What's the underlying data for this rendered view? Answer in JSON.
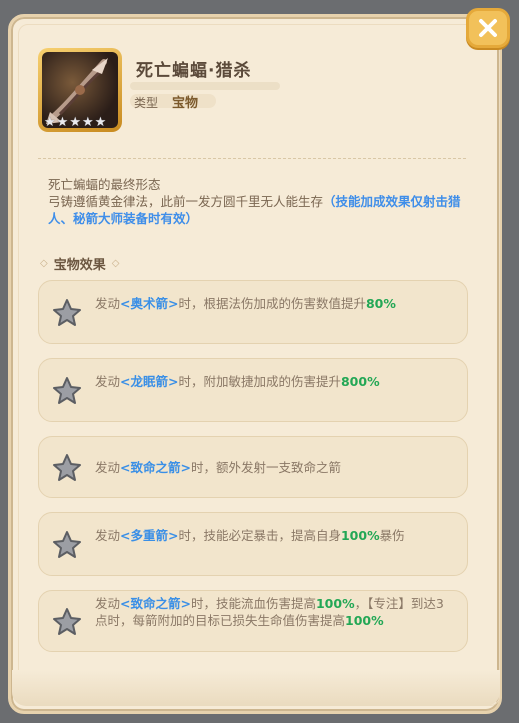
{
  "item": {
    "title": "死亡蝙蝠·猎杀",
    "type_label": "类型",
    "type_value": "宝物",
    "stars": [
      "★",
      "★",
      "★",
      "★",
      "★"
    ]
  },
  "description": {
    "line1": "死亡蝙蝠的最终形态",
    "line2": "弓铸遵循黄金律法，此前一发方圆千里无人能生存",
    "note": "（技能加成效果仅射击猎人、秘箭大师装备时有效）"
  },
  "section": {
    "title": "宝物效果"
  },
  "effects": [
    {
      "pre": "发动",
      "skill": "<奥术箭>",
      "mid": "时，根据法伤加成的伤害数值提升",
      "val": "80%",
      "post": ""
    },
    {
      "pre": "发动",
      "skill": "<龙眠箭>",
      "mid": "时，附加敏捷加成的伤害提升",
      "val": "800%",
      "post": ""
    },
    {
      "pre": "发动",
      "skill": "<致命之箭>",
      "mid": "时，额外发射一支致命之箭",
      "val": "",
      "post": ""
    },
    {
      "pre": "发动",
      "skill": "<多重箭>",
      "mid": "时，技能必定暴击，提高自身",
      "val": "100%",
      "post": "暴伤"
    },
    {
      "pre": "发动",
      "skill": "<致命之箭>",
      "mid": "时，技能流血伤害提高",
      "val": "100%",
      "post": "，【专注】到达3点时，每箭附加的目标已损失生命值伤害提高",
      "val2": "100%"
    }
  ],
  "colors": {
    "skill": "#3a8fe6",
    "value": "#23a755",
    "panel": "#f6ebd7",
    "close": "#f2c15a"
  },
  "icons": {
    "close": "close-icon",
    "effect": "star-icon",
    "item": "bow-icon"
  }
}
